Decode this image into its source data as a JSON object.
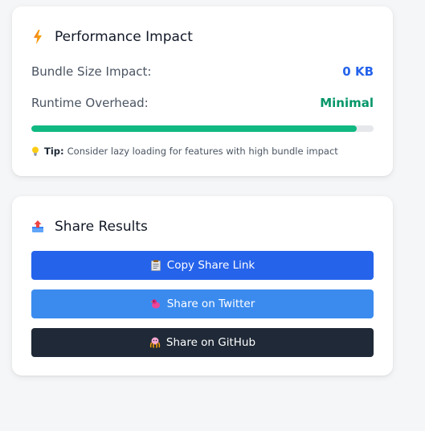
{
  "performance": {
    "title": "Performance Impact",
    "title_icon": "lightning-icon",
    "bundle_label": "Bundle Size Impact:",
    "bundle_value": "0 KB",
    "runtime_label": "Runtime Overhead:",
    "runtime_value": "Minimal",
    "progress": 0.95,
    "tip_icon": "lightbulb-icon",
    "tip_label": "Tip:",
    "tip_text": "Consider lazy loading for features with high bundle impact"
  },
  "share": {
    "title": "Share Results",
    "title_icon": "outbox-tray-icon",
    "copy_label": "Copy Share Link",
    "twitter_label": "Share on Twitter",
    "github_label": "Share on GitHub"
  },
  "colors": {
    "accent_blue": "#2563eb",
    "twitter_blue": "#3b8bef",
    "github_dark": "#1f2937",
    "success_green": "#10b981"
  }
}
